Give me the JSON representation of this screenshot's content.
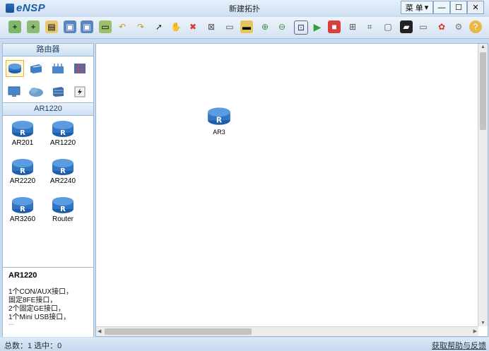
{
  "app": {
    "name": "eNSP",
    "window_title": "新建拓扑",
    "menu_label": "菜 单"
  },
  "toolbar": {
    "icons": [
      "new-topology-icon",
      "new-lab-icon",
      "open-icon",
      "save-icon",
      "save-as-icon",
      "print-icon",
      "undo-icon",
      "redo-icon",
      "select-icon",
      "pan-hand-icon",
      "delete-icon",
      "delete-link-icon",
      "text-note-icon",
      "rectangle-icon",
      "zoom-in-icon",
      "zoom-out-icon",
      "fit-icon",
      "start-icon",
      "stop-icon",
      "capture-icon",
      "topology-icon",
      "layout-icon",
      "terminal-icon",
      "console-icon",
      "huawei-icon",
      "settings-icon",
      "help-icon"
    ]
  },
  "left_panel": {
    "category_title": "路由器",
    "categories": [
      "router",
      "switch",
      "wlan",
      "firewall",
      "pc",
      "cloud",
      "server",
      "power"
    ],
    "device_group_title": "AR1220",
    "devices": [
      {
        "label": "AR201"
      },
      {
        "label": "AR1220"
      },
      {
        "label": "AR2220"
      },
      {
        "label": "AR2240"
      },
      {
        "label": "AR3260"
      },
      {
        "label": "Router"
      }
    ],
    "info": {
      "title": "AR1220",
      "lines": [
        "1个CON/AUX接口，",
        "固定8FE接口，",
        "2个固定GE接口，",
        "1个Mini USB接口，",
        "..."
      ]
    }
  },
  "canvas": {
    "node_label": "AR3"
  },
  "status": {
    "left": "总数：1  选中：0",
    "right": "获取帮助与反馈"
  },
  "colors": {
    "accent": "#1d5aa3",
    "router_blue": "#2f76c4",
    "panel_bg": "#c9dcef"
  }
}
